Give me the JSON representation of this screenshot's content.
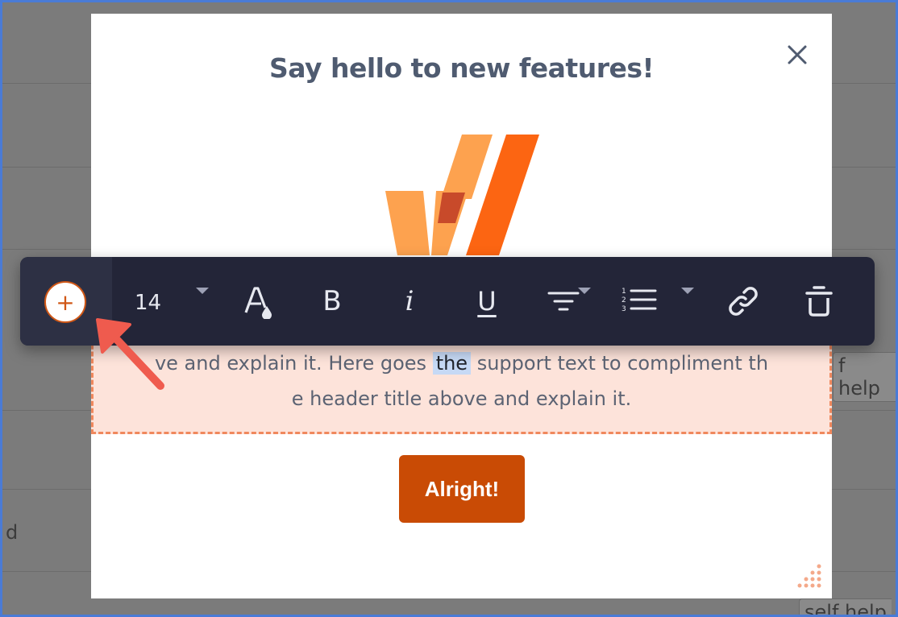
{
  "modal": {
    "title": "Say hello to new features!",
    "body_line1_before": "ve and explain it. Here goes ",
    "body_line1_highlight": "the",
    "body_line1_after": " support text to compliment th",
    "body_line2": "e header title above and explain it.",
    "button_label": "Alright!"
  },
  "toolbar": {
    "add_label": "+",
    "font_size": "14",
    "bold_label": "B",
    "italic_label": "i",
    "underline_label": "U",
    "text_color_label": "A"
  },
  "background": {
    "text_fragment_left": "d",
    "chip_fragment_right": "f help",
    "chip_fragment_bottom": "self help"
  },
  "colors": {
    "accent": "#c94b05",
    "toolbar_bg": "#232538",
    "text_block_bg": "#fde3da",
    "highlight": "#c6d9f5",
    "arrow": "#ef5b4e"
  },
  "icons": [
    "close-icon",
    "logo-icon",
    "text-color-icon",
    "align-icon",
    "ordered-list-icon",
    "link-icon",
    "trash-icon",
    "resize-handle-icon",
    "annotation-arrow-icon"
  ]
}
